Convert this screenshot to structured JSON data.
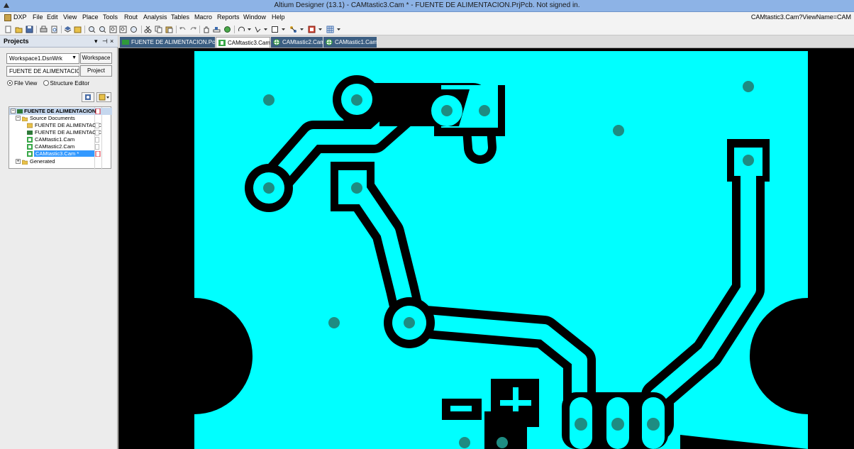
{
  "window": {
    "title": "Altium Designer (13.1) - CAMtastic3.Cam * - FUENTE DE ALIMENTACION.PrjPcb. Not signed in.",
    "view_name": "CAMtastic3.Cam?ViewName=CAM"
  },
  "menu": {
    "items": [
      "DXP",
      "File",
      "Edit",
      "View",
      "Place",
      "Tools",
      "Rout",
      "Analysis",
      "Tables",
      "Macro",
      "Reports",
      "Window",
      "Help"
    ]
  },
  "panel": {
    "title": "Projects",
    "controls": [
      "▾",
      "⊣",
      "×"
    ],
    "workspace_combo": "Workspace1.DsnWrk",
    "workspace_button": "Workspace",
    "project_combo": "FUENTE DE ALIMENTACION.Pr",
    "project_button": "Project",
    "view_modes": [
      "File View",
      "Structure Editor"
    ],
    "tree": {
      "project": "FUENTE DE ALIMENTACION.",
      "source_documents": "Source Documents",
      "files": [
        "FUENTE DE ALIMENTACIC",
        "FUENTE DE ALIMENTACIC",
        "CAMtastic1.Cam",
        "CAMtastic2.Cam",
        "CAMtastic3.Cam *"
      ],
      "generated": "Generated"
    }
  },
  "tabs": [
    "FUENTE DE ALIMENTACION.PcbDoc",
    "CAMtastic3.Cam *",
    "CAMtastic2.Cam",
    "CAMtastic1.Cam"
  ],
  "colors": {
    "copper": "#00ffff",
    "background": "#000000",
    "pad": "#1e8c82",
    "selection": "#3399ff"
  }
}
